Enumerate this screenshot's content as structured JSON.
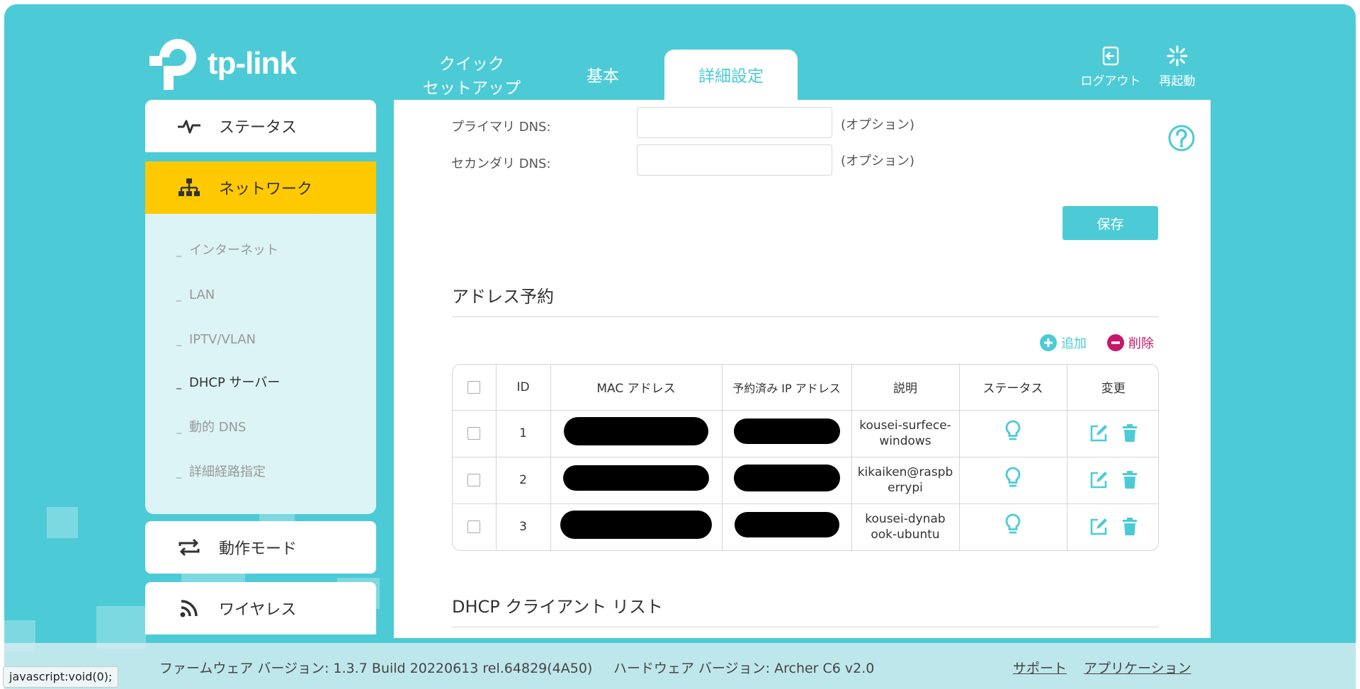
{
  "brand": {
    "name": "tp-link"
  },
  "nav": {
    "tabs": [
      {
        "label_line1": "クイック",
        "label_line2": "セットアップ"
      },
      {
        "label": "基本"
      },
      {
        "label": "詳細設定"
      }
    ],
    "actions": {
      "logout": "ログアウト",
      "reboot": "再起動"
    }
  },
  "sidebar": {
    "status": "ステータス",
    "network": "ネットワーク",
    "sub_items": [
      "インターネット",
      "LAN",
      "IPTV/VLAN",
      "DHCP サーバー",
      "動的 DNS",
      "詳細経路指定"
    ],
    "operation_mode": "動作モード",
    "wireless": "ワイヤレス"
  },
  "dns": {
    "primary_label": "プライマリ DNS:",
    "secondary_label": "セカンダリ DNS:",
    "primary_value": "",
    "secondary_value": "",
    "hint": "(オプション)"
  },
  "save_label": "保存",
  "reservation": {
    "title": "アドレス予約",
    "add_label": "追加",
    "delete_label": "削除",
    "headers": {
      "id": "ID",
      "mac": "MAC アドレス",
      "ip": "予約済み IP アドレス",
      "desc": "説明",
      "status": "ステータス",
      "edit": "変更"
    },
    "rows": [
      {
        "id": "1",
        "desc": "kousei-surfece-windows"
      },
      {
        "id": "2",
        "desc": "kikaiken@raspberrypi"
      },
      {
        "id": "3",
        "desc": "kousei-dynabook-ubuntu"
      }
    ]
  },
  "dhcp_clients": {
    "title": "DHCP クライアント リスト"
  },
  "footer": {
    "firmware": "ファームウェア バージョン: 1.3.7 Build 20220613 rel.64829(4A50)",
    "hardware": "ハードウェア バージョン: Archer C6 v2.0",
    "support": "サポート",
    "apps": "アプリケーション"
  },
  "status_tip": "javascript:void(0);",
  "colors": {
    "accent": "#4ccbd6",
    "active_menu": "#ffc900",
    "danger": "#c7166b"
  }
}
